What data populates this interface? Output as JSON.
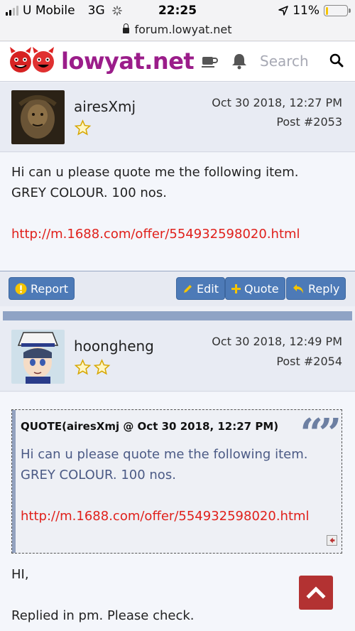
{
  "status": {
    "carrier": "U Mobile",
    "network": "3G",
    "time": "22:25",
    "battery": "11%",
    "battery_level": 0.11
  },
  "browser": {
    "url": "forum.lowyat.net"
  },
  "header": {
    "logo_text": "lowyat.net",
    "search_placeholder": "Search"
  },
  "posts": [
    {
      "username": "airesXmj",
      "stars": 1,
      "date": "Oct 30 2018, 12:27 PM",
      "post_no": "Post #2053",
      "lines": [
        "Hi can u please quote me the following item.",
        "GREY COLOUR. 100 nos."
      ],
      "link": "http://m.1688.com/offer/554932598020.html",
      "actions": {
        "report": "Report",
        "edit": "Edit",
        "quote": "Quote",
        "reply": "Reply"
      }
    },
    {
      "username": "hoongheng",
      "stars": 2,
      "date": "Oct 30 2018, 12:49 PM",
      "post_no": "Post #2054",
      "quote": {
        "title": "QUOTE(airesXmj @ Oct 30 2018, 12:27 PM)",
        "lines": [
          "Hi can u please quote me the following item.",
          "GREY COLOUR. 100 nos."
        ],
        "link": "http://m.1688.com/offer/554932598020.html"
      },
      "lines": [
        "HI,",
        "Replied in pm. Please check."
      ]
    }
  ],
  "colors": {
    "brand": "#9b1d8a",
    "button": "#4d7ab7",
    "link": "#e0201b",
    "scroll_top": "#b33232"
  }
}
